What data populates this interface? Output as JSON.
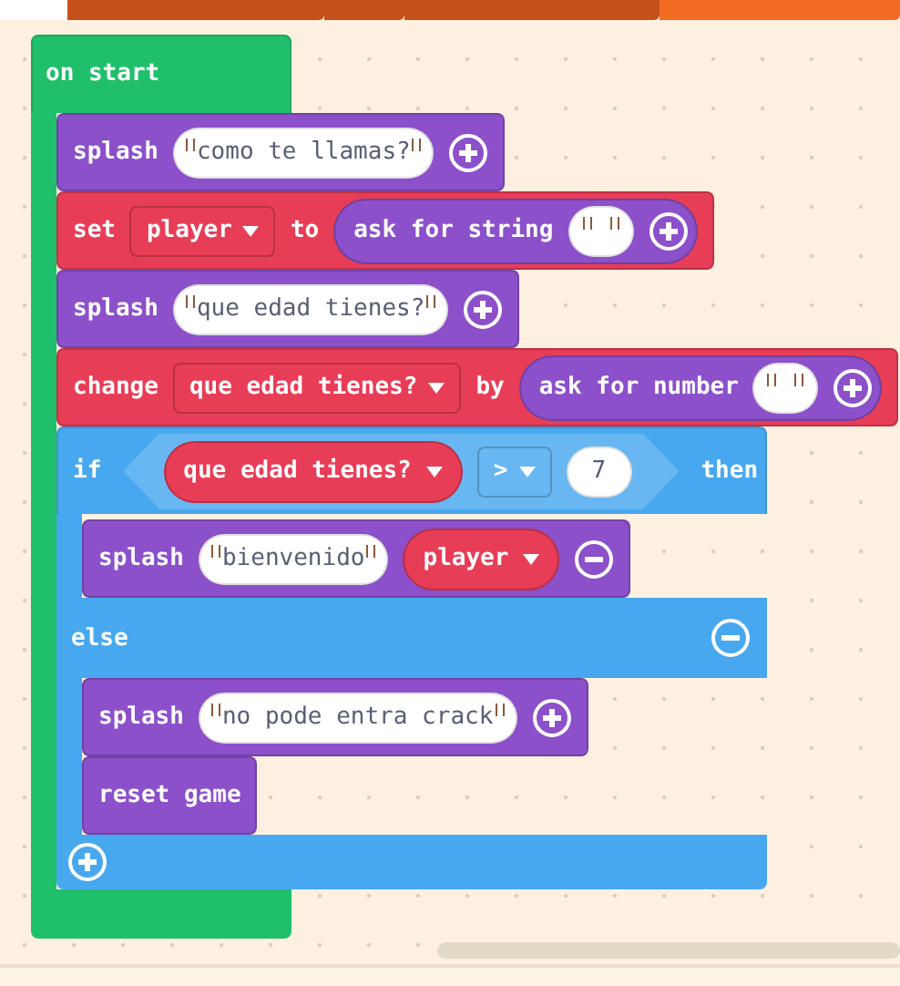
{
  "event": {
    "label": "on start",
    "color": "#20bf6b",
    "body": [
      {
        "kind": "statement",
        "color": "#8c50ca",
        "parts": [
          {
            "kind": "label",
            "text": "splash"
          },
          {
            "kind": "string",
            "text": "como te llamas?"
          },
          {
            "kind": "plus"
          }
        ]
      },
      {
        "kind": "statement",
        "color": "#e83d57",
        "parts": [
          {
            "kind": "label",
            "text": "set"
          },
          {
            "kind": "dropdown",
            "text": "player"
          },
          {
            "kind": "label",
            "text": "to"
          },
          {
            "kind": "reporter",
            "color": "#8c50ca",
            "parts": [
              {
                "kind": "label",
                "text": "ask for string"
              },
              {
                "kind": "string"
              },
              {
                "kind": "plus"
              }
            ]
          }
        ]
      },
      {
        "kind": "statement",
        "color": "#8c50ca",
        "parts": [
          {
            "kind": "label",
            "text": "splash"
          },
          {
            "kind": "string",
            "text": "que edad tienes?"
          },
          {
            "kind": "plus"
          }
        ]
      },
      {
        "kind": "statement",
        "color": "#e83d57",
        "parts": [
          {
            "kind": "label",
            "text": "change"
          },
          {
            "kind": "dropdown",
            "text": "que edad tienes?"
          },
          {
            "kind": "label",
            "text": "by"
          },
          {
            "kind": "reporter",
            "color": "#8c50ca",
            "parts": [
              {
                "kind": "label",
                "text": "ask for number"
              },
              {
                "kind": "string"
              },
              {
                "kind": "plus"
              }
            ]
          }
        ]
      },
      {
        "kind": "if",
        "color": "#47a8ef",
        "label": "if",
        "condition": [
          {
            "kind": "variable",
            "color": "#e83d57",
            "text": "que edad tienes?"
          },
          {
            "kind": "dropdown",
            "text": ">"
          },
          {
            "kind": "number",
            "text": "7"
          }
        ],
        "then_label": "then",
        "then": [
          {
            "kind": "statement",
            "color": "#8c50ca",
            "parts": [
              {
                "kind": "label",
                "text": "splash"
              },
              {
                "kind": "string",
                "text": "bienvenido"
              },
              {
                "kind": "variable",
                "color": "#e83d57",
                "text": "player"
              },
              {
                "kind": "minus"
              }
            ]
          }
        ],
        "else_label": "else",
        "else": [
          {
            "kind": "statement",
            "color": "#8c50ca",
            "parts": [
              {
                "kind": "label",
                "text": "splash"
              },
              {
                "kind": "string",
                "text": "no pode entra crack"
              },
              {
                "kind": "plus"
              }
            ]
          },
          {
            "kind": "statement",
            "color": "#8c50ca",
            "parts": [
              {
                "kind": "label",
                "text": "reset game"
              }
            ]
          }
        ]
      }
    ]
  }
}
